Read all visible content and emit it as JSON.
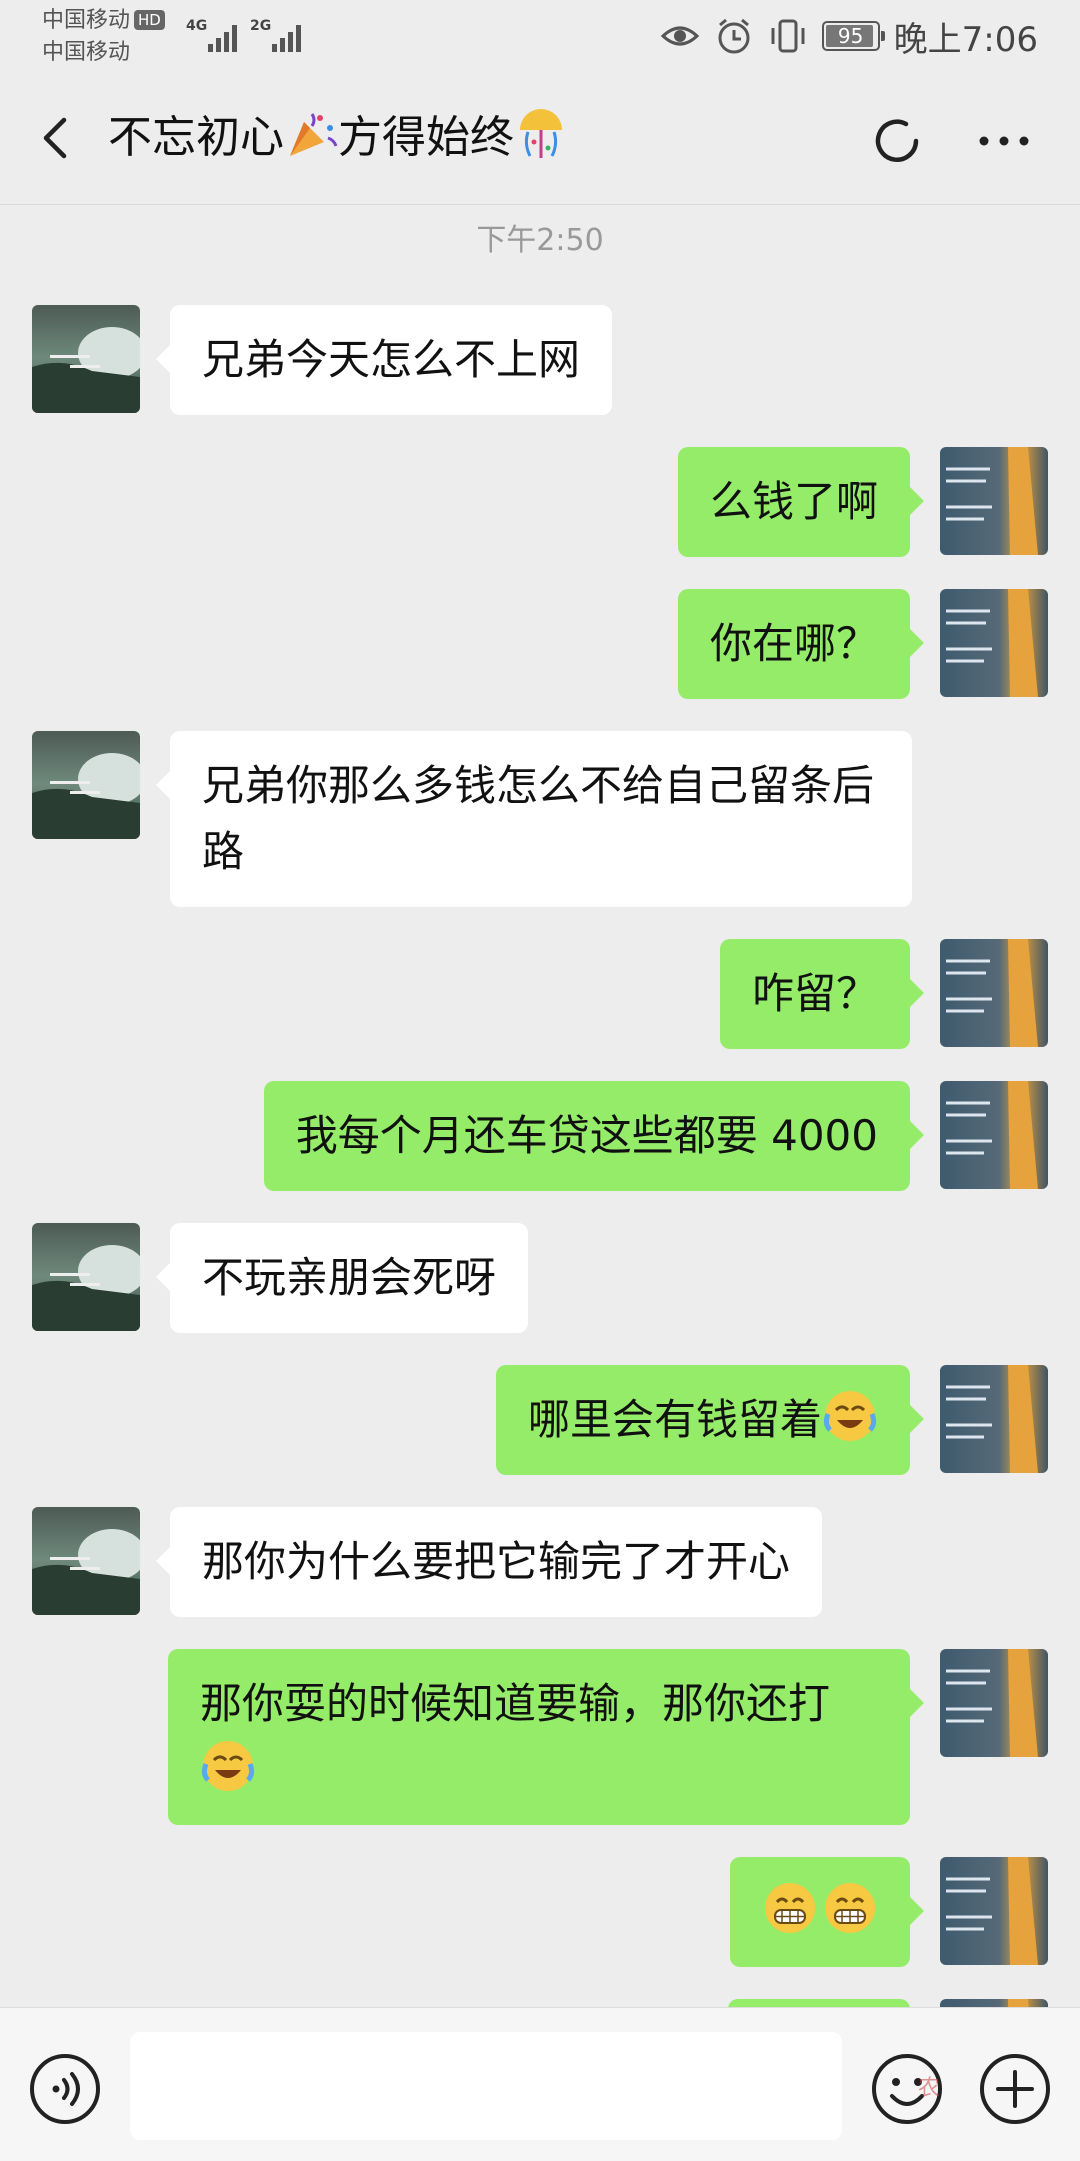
{
  "status_bar": {
    "carrier_1": "中国移动",
    "carrier_2": "中国移动",
    "hd_badge": "HD",
    "net_1": "4G",
    "net_2": "2G",
    "battery": "95",
    "battery_level": 0.95,
    "time": "晚上7:06",
    "icons": [
      "eye-icon",
      "alarm-icon",
      "vibrate-icon",
      "battery-icon"
    ]
  },
  "header": {
    "title_part1": "不忘初心",
    "title_part2": "方得始终",
    "title_emojis": [
      "party-popper-emoji",
      "confetti-ball-emoji"
    ],
    "icons": [
      "back-icon",
      "refresh-icon",
      "more-icon"
    ]
  },
  "chat": {
    "timestamp": "下午2:50",
    "messages": [
      {
        "side": "in",
        "text": "兄弟今天怎么不上网"
      },
      {
        "side": "out",
        "text": "么钱了啊"
      },
      {
        "side": "out",
        "text": "你在哪？"
      },
      {
        "side": "in",
        "text": "兄弟你那么多钱怎么不给自己留条后路"
      },
      {
        "side": "out",
        "text": "咋留？"
      },
      {
        "side": "out",
        "text": "我每个月还车贷这些都要 4000"
      },
      {
        "side": "in",
        "text": "不玩亲朋会死呀"
      },
      {
        "side": "out",
        "text": "哪里会有钱留着",
        "emoji": "laugh-cry-emoji"
      },
      {
        "side": "in",
        "text": "那你为什么要把它输完了才开心"
      },
      {
        "side": "out",
        "text": "那你耍的时候知道要输，那你还打",
        "emoji": "laugh-cry-emoji"
      },
      {
        "side": "out",
        "text": "",
        "emojis": [
          "grin-emoji",
          "grin-emoji"
        ]
      }
    ]
  },
  "input_bar": {
    "icons": [
      "voice-icon",
      "emoji-icon",
      "plus-icon"
    ],
    "watermark": "农"
  },
  "colors": {
    "background": "#ededed",
    "out_bubble": "#95ec69",
    "in_bubble": "#ffffff"
  }
}
